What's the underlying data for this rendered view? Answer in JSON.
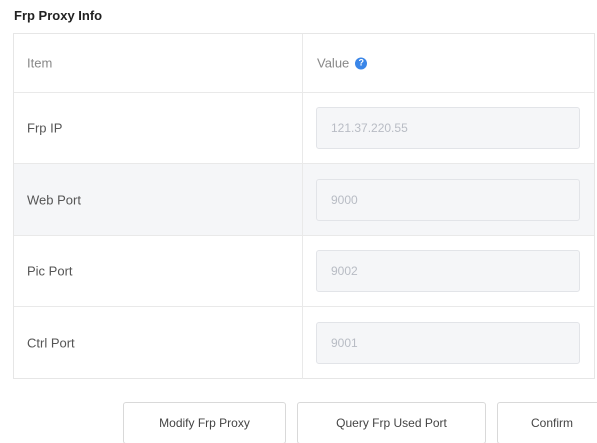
{
  "section": {
    "title": "Frp Proxy Info"
  },
  "table": {
    "header": {
      "item": "Item",
      "value": "Value"
    },
    "help_icon": "question-circle-icon",
    "rows": [
      {
        "label": "Frp IP",
        "value": "121.37.220.55"
      },
      {
        "label": "Web Port",
        "value": "9000"
      },
      {
        "label": "Pic Port",
        "value": "9002"
      },
      {
        "label": "Ctrl Port",
        "value": "9001"
      }
    ]
  },
  "buttons": {
    "modify": "Modify Frp Proxy",
    "query": "Query Frp Used Port",
    "confirm": "Confirm"
  },
  "colors": {
    "accent": "#3a86e8",
    "row_highlight": "#f5f6f8"
  }
}
